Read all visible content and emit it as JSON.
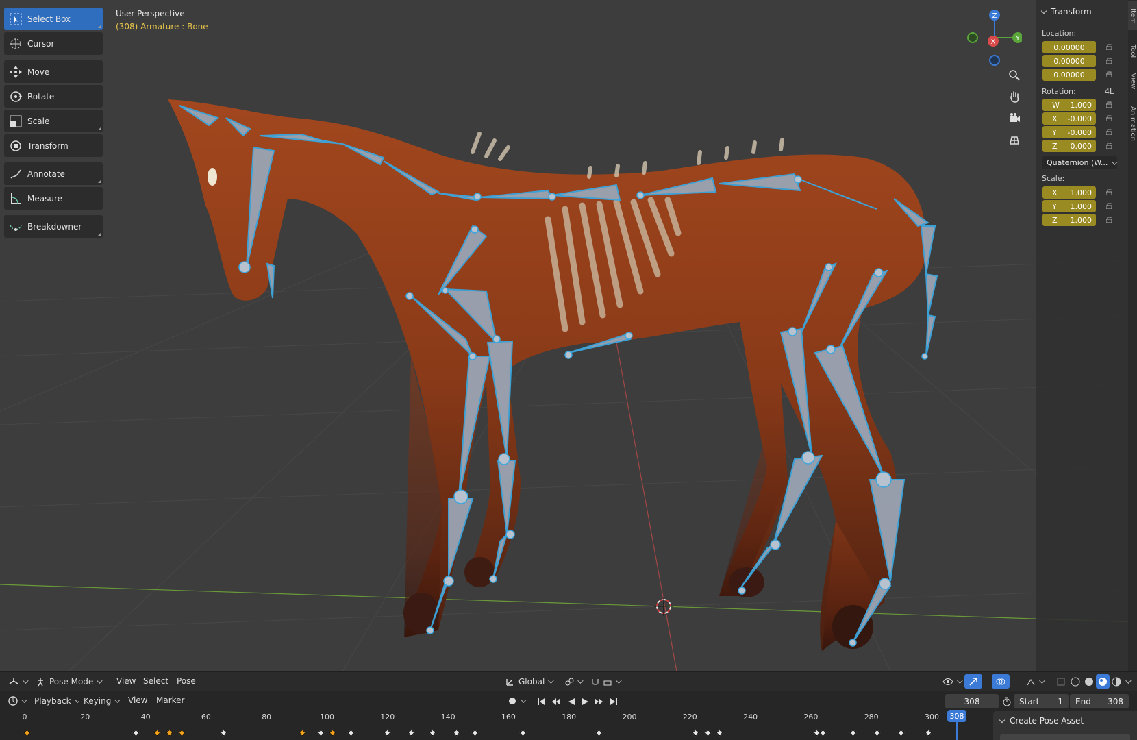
{
  "viewport": {
    "title": "User Perspective",
    "subtitle": "(308) Armature : Bone"
  },
  "toolbar": {
    "tools": [
      {
        "label": "Select Box",
        "icon": "select-box-icon",
        "active": true
      },
      {
        "label": "Cursor",
        "icon": "cursor-icon",
        "active": false
      },
      {
        "label": "Move",
        "icon": "move-icon",
        "active": false
      },
      {
        "label": "Rotate",
        "icon": "rotate-icon",
        "active": false
      },
      {
        "label": "Scale",
        "icon": "scale-icon",
        "active": false
      },
      {
        "label": "Transform",
        "icon": "transform-icon",
        "active": false
      },
      {
        "label": "Annotate",
        "icon": "annotate-icon",
        "active": false
      },
      {
        "label": "Measure",
        "icon": "measure-icon",
        "active": false
      },
      {
        "label": "Breakdowner",
        "icon": "breakdowner-icon",
        "active": false
      }
    ]
  },
  "gizmo": {
    "x_label": "X",
    "y_label": "Y",
    "z_label": "Z"
  },
  "npanel": {
    "header": "Transform",
    "location_label": "Location:",
    "location": [
      "0.00000",
      "0.00000",
      "0.00000"
    ],
    "rotation_label": "Rotation:",
    "rotation_mode_tag": "4L",
    "rotation": [
      {
        "axis": "W",
        "value": "1.000"
      },
      {
        "axis": "X",
        "value": "-0.000"
      },
      {
        "axis": "Y",
        "value": "-0.000"
      },
      {
        "axis": "Z",
        "value": "0.000"
      }
    ],
    "rotation_mode": "Quaternion (W...",
    "scale_label": "Scale:",
    "scale": [
      {
        "axis": "X",
        "value": "1.000"
      },
      {
        "axis": "Y",
        "value": "1.000"
      },
      {
        "axis": "Z",
        "value": "1.000"
      }
    ],
    "tabs": [
      "Item",
      "Tool",
      "View",
      "Animation"
    ]
  },
  "header3d": {
    "mode": "Pose Mode",
    "menus": [
      "View",
      "Select",
      "Pose"
    ],
    "orientation": "Global"
  },
  "timeline_header": {
    "menus": [
      "Playback",
      "Keying",
      "View",
      "Marker"
    ],
    "current_frame": "308",
    "start_label": "Start",
    "start_value": "1",
    "end_label": "End",
    "end_value": "308"
  },
  "timeline": {
    "ticks": [
      "0",
      "20",
      "40",
      "60",
      "80",
      "100",
      "120",
      "140",
      "160",
      "180",
      "200",
      "220",
      "240",
      "260",
      "280",
      "300"
    ],
    "playhead": "308",
    "keyframes": [
      1,
      37,
      44,
      48,
      52,
      66,
      92,
      98,
      102,
      108,
      120,
      128,
      135,
      143,
      149,
      165,
      190,
      222,
      226,
      230,
      262,
      264,
      274,
      282,
      290,
      299
    ],
    "selected_keyframes": [
      1,
      44,
      48,
      52,
      92,
      102
    ]
  },
  "pose_panel": {
    "title": "Create Pose Asset"
  },
  "colors": {
    "active_tool": "#2f6ebf",
    "field_animated": "#9a8a22",
    "bone_outline": "#3aa6de",
    "playhead": "#3b7ad6"
  }
}
